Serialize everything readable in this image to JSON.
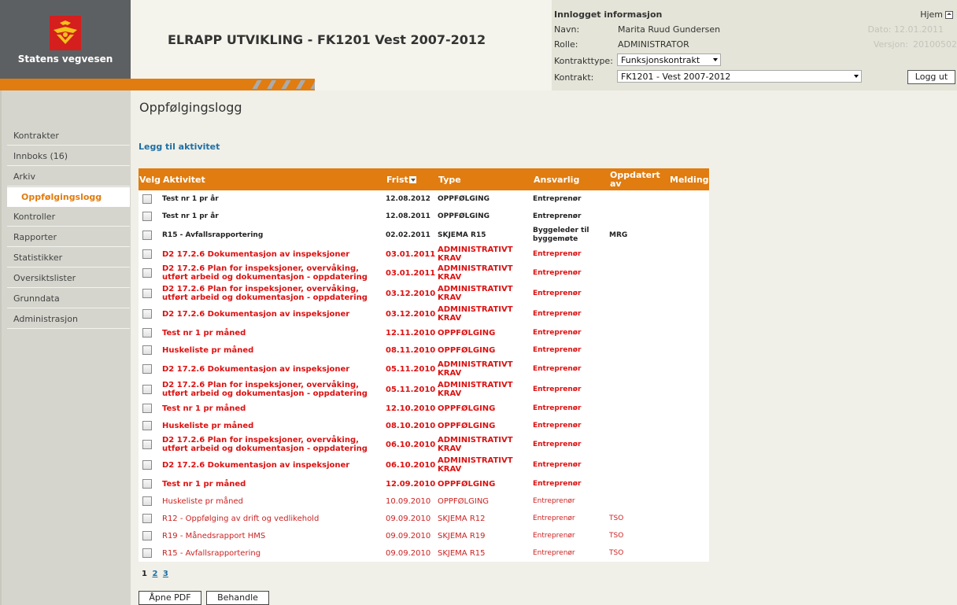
{
  "brand": {
    "name": "Statens vegvesen"
  },
  "app_title": "ELRAPP UTVIKLING - FK1201 Vest 2007-2012",
  "info": {
    "title": "Innlogget informasjon",
    "home_label": "Hjem",
    "navn_label": "Navn:",
    "navn_value": "Marita Ruud Gundersen",
    "rolle_label": "Rolle:",
    "rolle_value": "ADMINISTRATOR",
    "dato_label": "Dato: 12.01.2011",
    "versjon_label": "Versjon:",
    "versjon_value": "20100502",
    "kontrakttype_label": "Kontrakttype:",
    "kontrakttype_value": "Funksjonskontrakt",
    "kontrakt_label": "Kontrakt:",
    "kontrakt_value": "FK1201 - Vest 2007-2012",
    "logout_label": "Logg ut"
  },
  "sidebar": {
    "items": [
      {
        "label": "Kontrakter"
      },
      {
        "label": "Innboks (16)"
      },
      {
        "label": "Arkiv"
      },
      {
        "label": "Oppfølgingslogg",
        "active": true
      },
      {
        "label": "Kontroller"
      },
      {
        "label": "Rapporter"
      },
      {
        "label": "Statistikker"
      },
      {
        "label": "Oversiktslister"
      },
      {
        "label": "Grunndata"
      },
      {
        "label": "Administrasjon"
      }
    ]
  },
  "main": {
    "page_title": "Oppfølgingslogg",
    "add_link": "Legg til aktivitet",
    "columns": {
      "velg": "Velg",
      "aktivitet": "Aktivitet",
      "frist": "Frist",
      "type": "Type",
      "ansvarlig": "Ansvarlig",
      "oppdatert_av": "Oppdatert av",
      "melding": "Melding"
    },
    "rows": [
      {
        "aktivitet": "Test nr 1 pr år",
        "frist": "12.08.2012",
        "type": "OPPFØLGING",
        "ansvarlig": "Entreprenør",
        "oppdatert_av": "",
        "style": "black"
      },
      {
        "aktivitet": "Test nr 1 pr år",
        "frist": "12.08.2011",
        "type": "OPPFØLGING",
        "ansvarlig": "Entreprenør",
        "oppdatert_av": "",
        "style": "black"
      },
      {
        "aktivitet": "R15 - Avfallsrapportering",
        "frist": "02.02.2011",
        "type": "SKJEMA R15",
        "ansvarlig": "Byggeleder til byggemøte",
        "oppdatert_av": "MRG",
        "style": "black",
        "tall": true
      },
      {
        "aktivitet": "D2 17.2.6 Dokumentasjon av inspeksjoner",
        "frist": "03.01.2011",
        "type": "ADMINISTRATIVT KRAV",
        "ansvarlig": "Entreprenør",
        "oppdatert_av": "",
        "style": "red"
      },
      {
        "aktivitet": "D2 17.2.6 Plan for inspeksjoner, overvåking, utført arbeid og dokumentasjon - oppdatering",
        "frist": "03.01.2011",
        "type": "ADMINISTRATIVT KRAV",
        "ansvarlig": "Entreprenør",
        "oppdatert_av": "",
        "style": "red",
        "tall": true
      },
      {
        "aktivitet": "D2 17.2.6 Plan for inspeksjoner, overvåking, utført arbeid og dokumentasjon - oppdatering",
        "frist": "03.12.2010",
        "type": "ADMINISTRATIVT KRAV",
        "ansvarlig": "Entreprenør",
        "oppdatert_av": "",
        "style": "red",
        "tall": true
      },
      {
        "aktivitet": "D2 17.2.6 Dokumentasjon av inspeksjoner",
        "frist": "03.12.2010",
        "type": "ADMINISTRATIVT KRAV",
        "ansvarlig": "Entreprenør",
        "oppdatert_av": "",
        "style": "red",
        "tall": true
      },
      {
        "aktivitet": "Test nr 1 pr måned",
        "frist": "12.11.2010",
        "type": "OPPFØLGING",
        "ansvarlig": "Entreprenør",
        "oppdatert_av": "",
        "style": "red"
      },
      {
        "aktivitet": "Huskeliste pr måned",
        "frist": "08.11.2010",
        "type": "OPPFØLGING",
        "ansvarlig": "Entreprenør",
        "oppdatert_av": "",
        "style": "red"
      },
      {
        "aktivitet": "D2 17.2.6 Dokumentasjon av inspeksjoner",
        "frist": "05.11.2010",
        "type": "ADMINISTRATIVT KRAV",
        "ansvarlig": "Entreprenør",
        "oppdatert_av": "",
        "style": "red",
        "tall": true
      },
      {
        "aktivitet": "D2 17.2.6 Plan for inspeksjoner, overvåking, utført arbeid og dokumentasjon - oppdatering",
        "frist": "05.11.2010",
        "type": "ADMINISTRATIVT KRAV",
        "ansvarlig": "Entreprenør",
        "oppdatert_av": "",
        "style": "red",
        "tall": true
      },
      {
        "aktivitet": "Test nr 1 pr måned",
        "frist": "12.10.2010",
        "type": "OPPFØLGING",
        "ansvarlig": "Entreprenør",
        "oppdatert_av": "",
        "style": "red"
      },
      {
        "aktivitet": "Huskeliste pr måned",
        "frist": "08.10.2010",
        "type": "OPPFØLGING",
        "ansvarlig": "Entreprenør",
        "oppdatert_av": "",
        "style": "red"
      },
      {
        "aktivitet": "D2 17.2.6 Plan for inspeksjoner, overvåking, utført arbeid og dokumentasjon - oppdatering",
        "frist": "06.10.2010",
        "type": "ADMINISTRATIVT KRAV",
        "ansvarlig": "Entreprenør",
        "oppdatert_av": "",
        "style": "red",
        "tall": true
      },
      {
        "aktivitet": "D2 17.2.6 Dokumentasjon av inspeksjoner",
        "frist": "06.10.2010",
        "type": "ADMINISTRATIVT KRAV",
        "ansvarlig": "Entreprenør",
        "oppdatert_av": "",
        "style": "red",
        "tall": true
      },
      {
        "aktivitet": "Test nr 1 pr måned",
        "frist": "12.09.2010",
        "type": "OPPFØLGING",
        "ansvarlig": "Entreprenør",
        "oppdatert_av": "",
        "style": "red"
      },
      {
        "aktivitet": "Huskeliste pr måned",
        "frist": "10.09.2010",
        "type": "OPPFØLGING",
        "ansvarlig": "Entreprenør",
        "oppdatert_av": "",
        "style": "red-plain"
      },
      {
        "aktivitet": "R12 - Oppfølging av drift og vedlikehold",
        "frist": "09.09.2010",
        "type": "SKJEMA R12",
        "ansvarlig": "Entreprenør",
        "oppdatert_av": "TSO",
        "style": "red-plain"
      },
      {
        "aktivitet": "R19 - Månedsrapport HMS",
        "frist": "09.09.2010",
        "type": "SKJEMA R19",
        "ansvarlig": "Entreprenør",
        "oppdatert_av": "TSO",
        "style": "red-plain"
      },
      {
        "aktivitet": "R15 - Avfallsrapportering",
        "frist": "09.09.2010",
        "type": "SKJEMA R15",
        "ansvarlig": "Entreprenør",
        "oppdatert_av": "TSO",
        "style": "red-plain"
      }
    ],
    "pager": {
      "current": "1",
      "pages": [
        "2",
        "3"
      ]
    },
    "buttons": {
      "open_pdf": "Åpne PDF",
      "process": "Behandle"
    }
  },
  "colors": {
    "accent": "#e07c10",
    "link": "#1e6fa5",
    "overdue": "#dd1111",
    "logo_bg": "#5d6062"
  }
}
